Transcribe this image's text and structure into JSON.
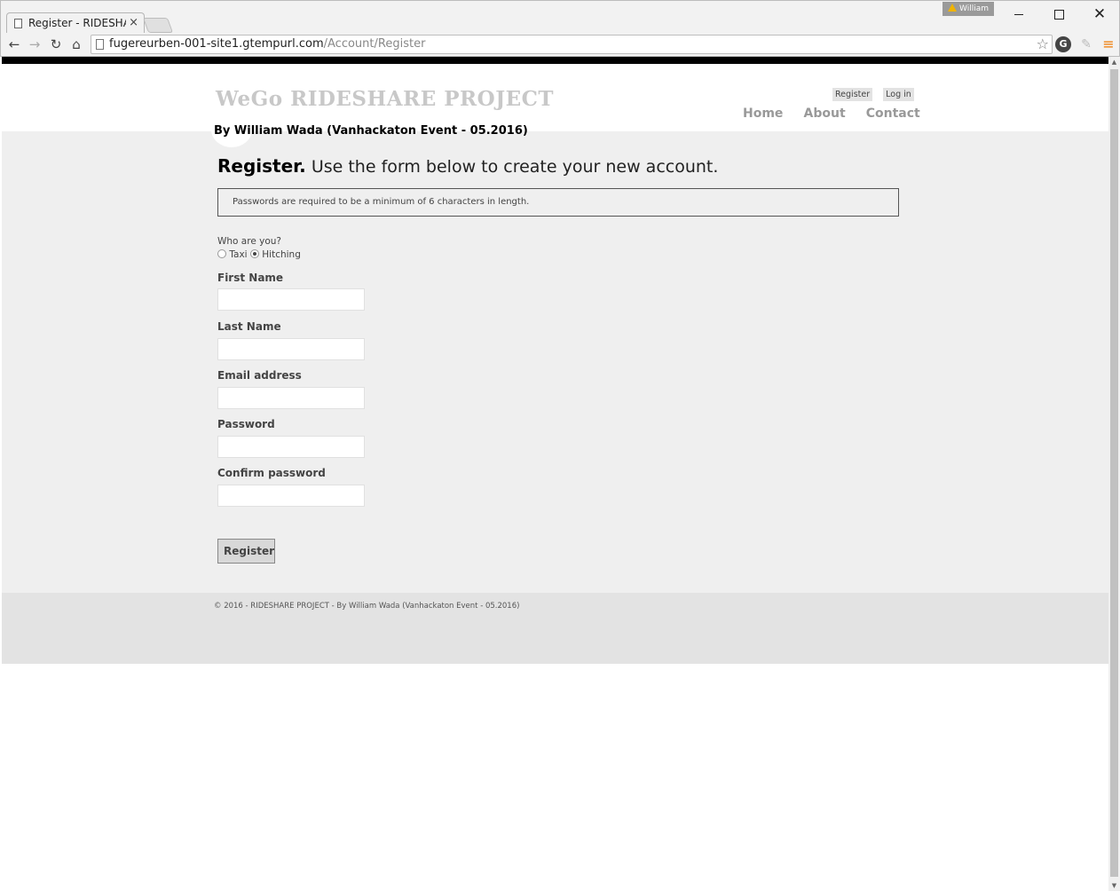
{
  "browser": {
    "tab_title": "Register - RIDESHAR",
    "tab_close": "×",
    "user_badge": "William",
    "url_host": "fugereurben-001-site1.gtempurl.com",
    "url_path": "/Account/Register",
    "icons": {
      "back": "back-arrow-icon",
      "forward": "forward-arrow-icon",
      "reload": "reload-icon",
      "home": "home-icon",
      "bookmark": "star-icon",
      "menu": "hamburger-icon"
    }
  },
  "site": {
    "title": "WeGo RIDESHARE PROJECT",
    "subtitle": "By William Wada (Vanhackaton Event - 05.2016)",
    "login_links": [
      "Register",
      "Log in"
    ],
    "nav": [
      "Home",
      "About",
      "Contact"
    ]
  },
  "page": {
    "heading_bold": "Register.",
    "heading_rest": " Use the form below to create your new account.",
    "message": "Passwords are required to be a minimum of 6 characters in length."
  },
  "form": {
    "who_label": "Who are you?",
    "role_options": [
      {
        "label": "Taxi",
        "selected": false
      },
      {
        "label": "Hitching",
        "selected": true
      }
    ],
    "fields": [
      {
        "label": "First Name",
        "value": ""
      },
      {
        "label": "Last Name",
        "value": ""
      },
      {
        "label": "Email address",
        "value": ""
      },
      {
        "label": "Password",
        "value": ""
      },
      {
        "label": "Confirm password",
        "value": ""
      }
    ],
    "submit_label": "Register"
  },
  "footer": {
    "text": "© 2016 - RIDESHARE PROJECT - By William Wada (Vanhackaton Event - 05.2016)"
  },
  "colors": {
    "title_gray": "#c8c8c8",
    "body_bg": "#efefef",
    "footer_bg": "#e3e3e3",
    "top_bar": "#000000"
  }
}
